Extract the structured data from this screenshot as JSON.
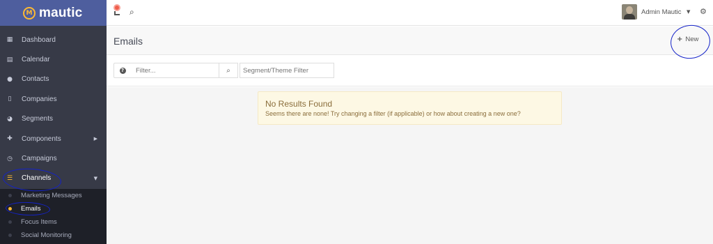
{
  "brand": {
    "logo_mark": "M",
    "name": "mautic"
  },
  "sidebar": {
    "items": [
      {
        "label": "Dashboard",
        "icon": "dashboard-icon",
        "glyph": "▦"
      },
      {
        "label": "Calendar",
        "icon": "calendar-icon",
        "glyph": "▤"
      },
      {
        "label": "Contacts",
        "icon": "user-icon",
        "glyph": "●"
      },
      {
        "label": "Companies",
        "icon": "building-icon",
        "glyph": "▯"
      },
      {
        "label": "Segments",
        "icon": "pie-chart-icon",
        "glyph": "◕"
      },
      {
        "label": "Components",
        "icon": "puzzle-icon",
        "glyph": "✚",
        "caret": "▶"
      },
      {
        "label": "Campaigns",
        "icon": "clock-icon",
        "glyph": "◷"
      },
      {
        "label": "Channels",
        "icon": "rss-icon",
        "glyph": "☰",
        "caret": "▼"
      }
    ],
    "sub_items": [
      {
        "label": "Marketing Messages"
      },
      {
        "label": "Emails"
      },
      {
        "label": "Focus Items"
      },
      {
        "label": "Social Monitoring"
      }
    ]
  },
  "topbar": {
    "search_glyph": "⌕",
    "user_name": "Admin Mautic",
    "user_caret": "▼",
    "gear_glyph": "⚙"
  },
  "page": {
    "title": "Emails",
    "new_button_plus": "+",
    "new_button_label": "New"
  },
  "filters": {
    "help_glyph": "?",
    "filter_placeholder": "Filter...",
    "search_glyph": "⌕",
    "segment_placeholder": "Segment/Theme Filter"
  },
  "alert": {
    "title": "No Results Found",
    "message": "Seems there are none! Try changing a filter (if applicable) or how about creating a new one?"
  },
  "colors": {
    "sidebar_bg": "#373a47",
    "logo_bar_bg": "#4e5e9e",
    "accent": "#fdb933",
    "alert_bg": "#fdf8e4",
    "annotation": "#1422c8"
  }
}
